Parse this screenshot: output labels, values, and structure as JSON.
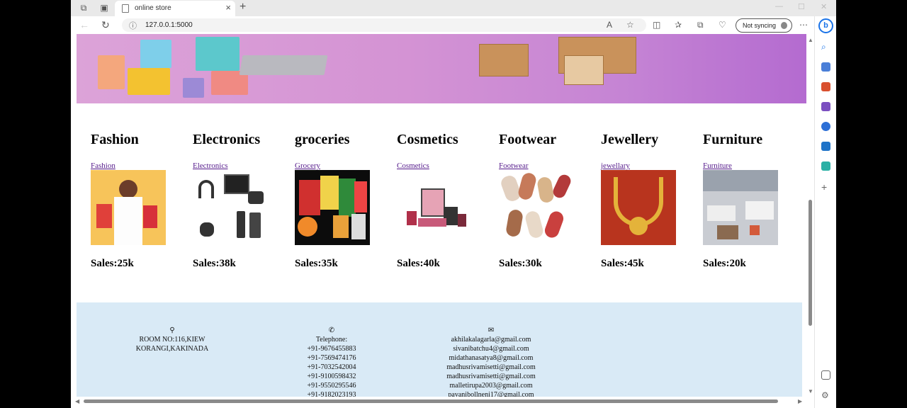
{
  "browser": {
    "tab_title": "online store",
    "url": "127.0.0.1:5000",
    "sync_label": "Not syncing"
  },
  "categories": [
    {
      "name": "Fashion",
      "link": "Fashion",
      "sales": "Sales:25k"
    },
    {
      "name": "Electronics",
      "link": "Electronics",
      "sales": "Sales:38k"
    },
    {
      "name": "groceries",
      "link": "Grocery",
      "sales": "Sales:35k"
    },
    {
      "name": "Cosmetics",
      "link": "Cosmetics",
      "sales": "Sales:40k"
    },
    {
      "name": "Footwear",
      "link": "Footwear",
      "sales": "Sales:30k"
    },
    {
      "name": "Jewellery",
      "link": "jewellary",
      "sales": "Sales:45k"
    },
    {
      "name": "Furniture",
      "link": "Furniture",
      "sales": "Sales:20k"
    }
  ],
  "footer": {
    "address": [
      "ROOM NO:116,KIEW",
      "KORANGI,KAKINADA"
    ],
    "telephone_label": "Telephone:",
    "phones": [
      "+91-9676455883",
      "+91-7569474176",
      "+91-7032542004",
      "+91-9100598432",
      "+91-9550295546",
      "+91-9182023193"
    ],
    "emails": [
      "akhilakalagarla@gmail.com",
      "sivanibatchu4@gmail.com",
      "midathanasatya8@gmail.com",
      "madhusrivamisetti@gmail.com",
      "madhusrivamisetti@gmail.com",
      "malletirupa2003@gmail.com",
      "pavanibollneni17@gmail.com"
    ]
  }
}
